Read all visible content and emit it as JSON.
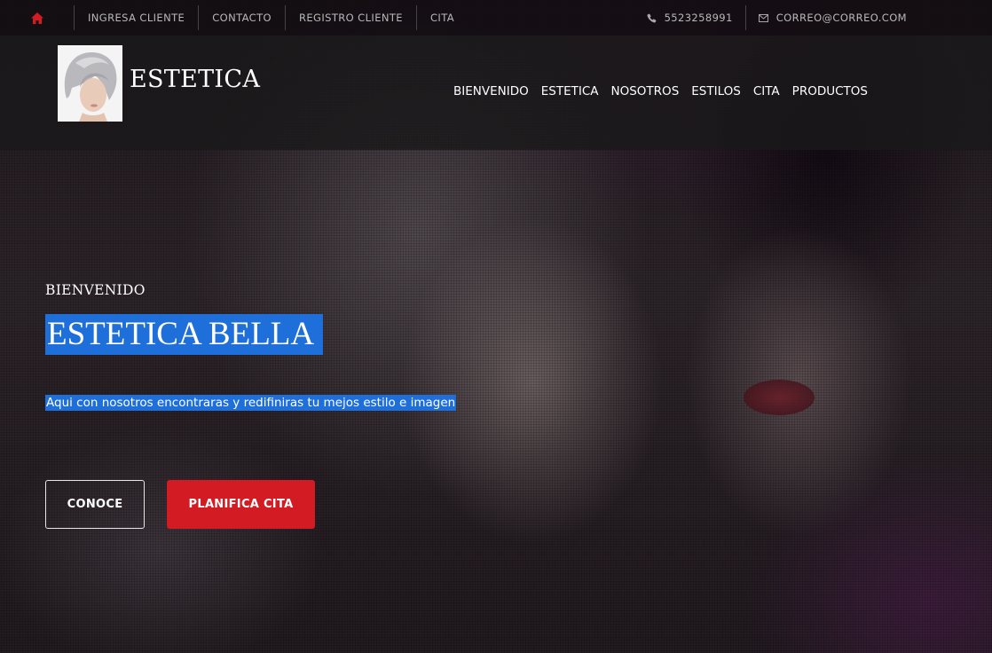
{
  "topbar": {
    "links": [
      {
        "label": "INGRESA CLIENTE"
      },
      {
        "label": "CONTACTO"
      },
      {
        "label": "REGISTRO CLIENTE"
      },
      {
        "label": "CITA"
      }
    ],
    "phone": "5523258991",
    "email": "CORREO@CORREO.COM",
    "home_icon": "home-icon",
    "accent_color": "#d21b22"
  },
  "header": {
    "brand": "ESTETICA",
    "nav": [
      {
        "label": "BIENVENIDO"
      },
      {
        "label": "ESTETICA"
      },
      {
        "label": "NOSOTROS"
      },
      {
        "label": "ESTILOS"
      },
      {
        "label": "CITA"
      },
      {
        "label": "PRODUCTOS"
      }
    ]
  },
  "hero": {
    "eyebrow": "BIENVENIDO",
    "title": "ESTETICA BELLA",
    "subtitle": "Aqui con nosotros encontraras y redifiniras tu mejos estilo e imagen",
    "primary_button": "CONOCE",
    "secondary_button": "PLANIFICA CITA",
    "selection_color": "#1e6fd9",
    "button_color": "#d21b22"
  }
}
